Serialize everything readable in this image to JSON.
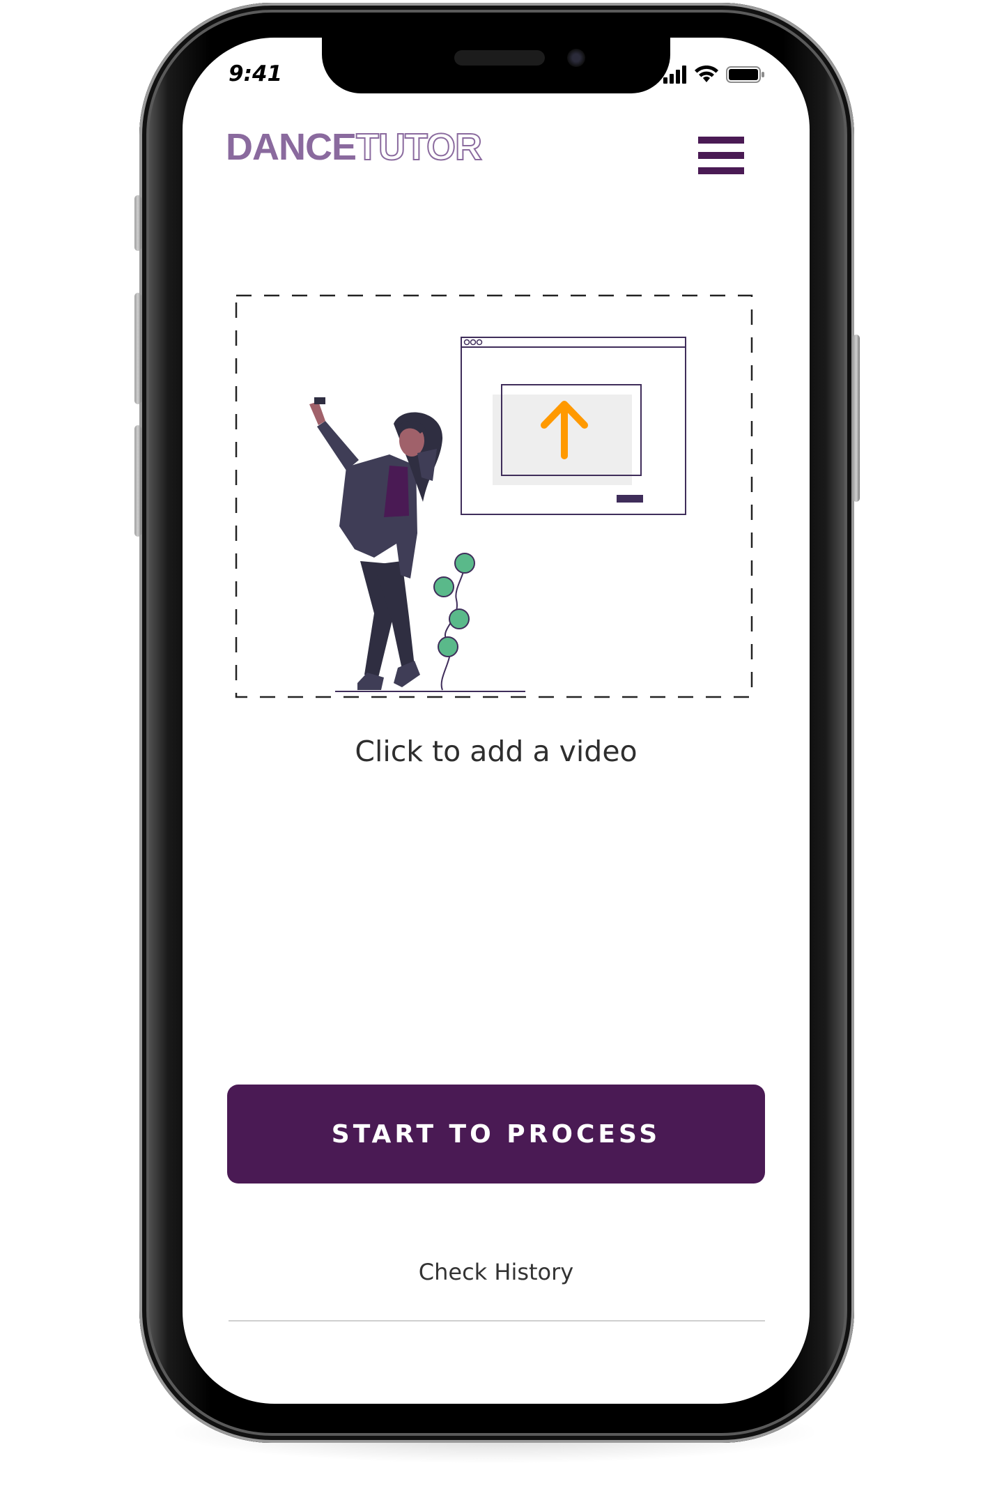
{
  "status_bar": {
    "time": "9:41"
  },
  "header": {
    "logo_part_1": "DANCE",
    "logo_part_2": "TUTOR",
    "menu_icon": "hamburger-menu-icon"
  },
  "upload": {
    "caption": "Click to add a video",
    "illustration": "person-uploading-illustration",
    "upload_icon": "up-arrow-icon"
  },
  "actions": {
    "primary_label": "START TO PROCESS",
    "secondary_label": "Check History"
  },
  "colors": {
    "brand": "#4a1a54",
    "logo": "#8a6a9e",
    "arrow": "#ff9900",
    "plant": "#5ab98a"
  }
}
